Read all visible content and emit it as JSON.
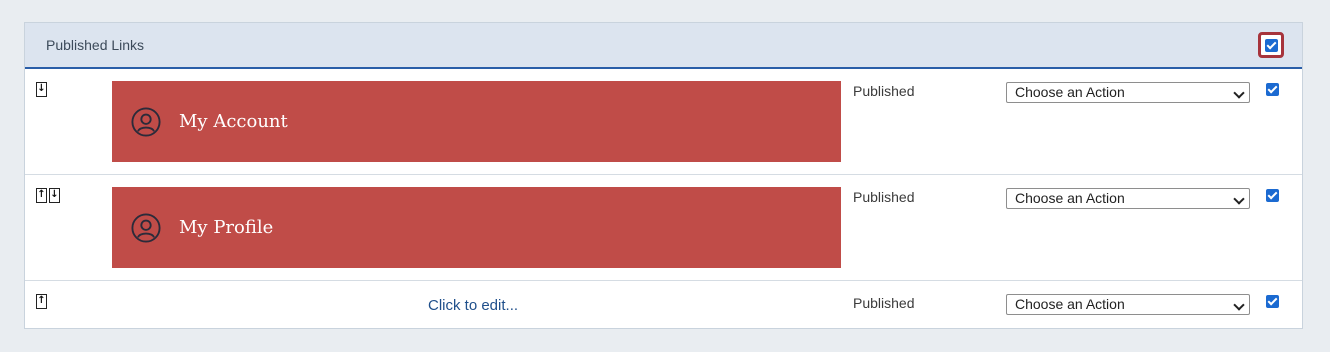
{
  "panel": {
    "title": "Published Links",
    "select_all_checked": true
  },
  "rows": [
    {
      "arrows": [
        "down"
      ],
      "tile_label": "My Account",
      "tile_icon": "user-circle-icon",
      "status": "Published",
      "action": "Choose an Action",
      "checked": true
    },
    {
      "arrows": [
        "up",
        "down"
      ],
      "tile_label": "My Profile",
      "tile_icon": "user-circle-icon",
      "status": "Published",
      "action": "Choose an Action",
      "checked": true
    },
    {
      "arrows": [
        "up"
      ],
      "edit_text": "Click to edit...",
      "status": "Published",
      "action": "Choose an Action",
      "checked": true
    }
  ],
  "colors": {
    "tile": "#c04c48",
    "header_bg": "#dce4ef",
    "header_rule": "#2a5ea8",
    "highlight": "#a7343c",
    "checkbox": "#1b6ad1"
  }
}
